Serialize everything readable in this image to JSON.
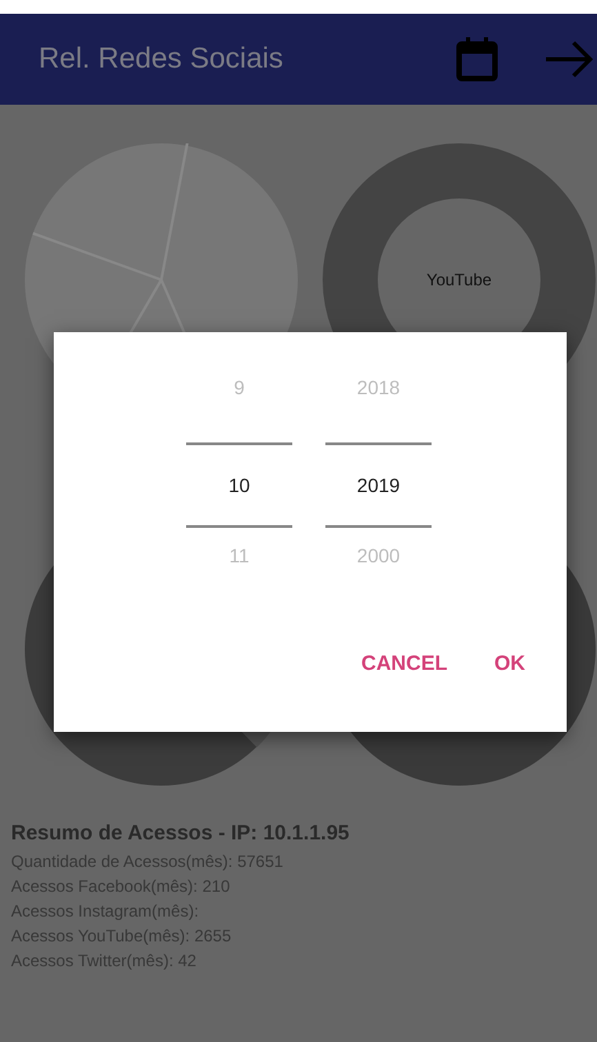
{
  "app_bar": {
    "title": "Rel. Redes Sociais"
  },
  "charts": [
    {
      "kind": "pie"
    },
    {
      "kind": "donut",
      "label": "YouTube"
    },
    {
      "kind": "pie_dark"
    },
    {
      "kind": "donut_dark"
    }
  ],
  "dialog": {
    "pickers": [
      {
        "items": [
          {
            "label": "9",
            "selected": false
          },
          {
            "label": "10",
            "selected": true
          },
          {
            "label": "11",
            "selected": false
          }
        ]
      },
      {
        "items": [
          {
            "label": "2018",
            "selected": false
          },
          {
            "label": "2019",
            "selected": true
          },
          {
            "label": "2000",
            "selected": false
          }
        ]
      }
    ],
    "buttons": [
      "CANCEL",
      "OK"
    ]
  },
  "summary": {
    "title": "Resumo de Acessos - IP: 10.1.1.95",
    "lines": [
      "Quantidade de Acessos(mês): 57651",
      "Acessos Facebook(mês): 210",
      "Acessos Instagram(mês):",
      "Acessos YouTube(mês): 2655",
      "Acessos Twitter(mês): 42"
    ]
  }
}
